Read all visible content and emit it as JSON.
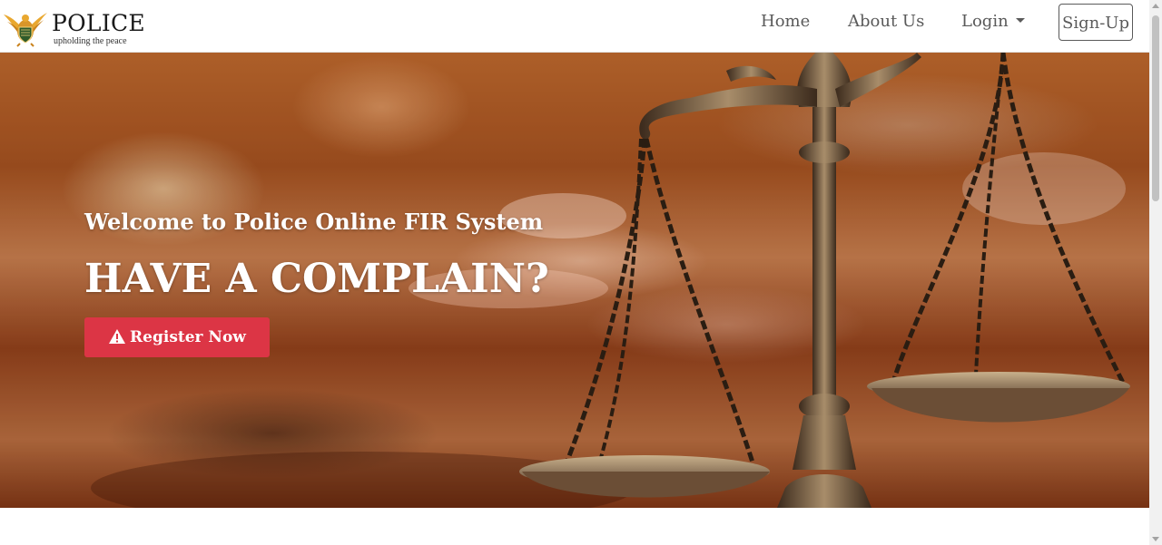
{
  "brand": {
    "name": "POLICE",
    "tagline": "upholding the peace"
  },
  "nav": {
    "home": "Home",
    "about": "About Us",
    "login": "Login",
    "signup": "Sign-Up"
  },
  "hero": {
    "welcome": "Welcome to Police Online FIR System",
    "headline": "HAVE A COMPLAIN?",
    "button_label": "Register Now",
    "button_icon": "warning-icon"
  },
  "colors": {
    "button": "#dc3545",
    "nav_text": "#5a5a5a"
  }
}
